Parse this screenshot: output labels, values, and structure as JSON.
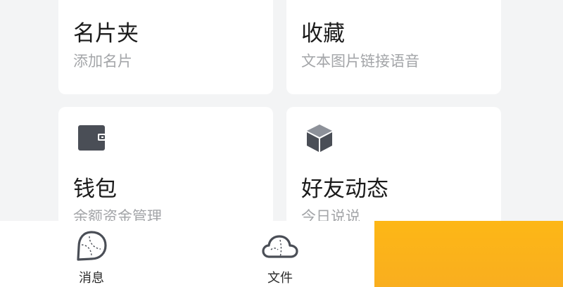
{
  "cards": [
    {
      "title": "名片夹",
      "subtitle": "添加名片"
    },
    {
      "title": "收藏",
      "subtitle": "文本图片链接语音"
    },
    {
      "title": "钱包",
      "subtitle": "余额资金管理",
      "icon": "wallet-icon"
    },
    {
      "title": "好友动态",
      "subtitle": "今日说说",
      "icon": "cube-icon"
    }
  ],
  "tabbar": {
    "items": [
      {
        "label": "消息",
        "icon": "message-bubble-icon"
      },
      {
        "label": "文件",
        "icon": "cloud-icon"
      }
    ]
  },
  "colors": {
    "background": "#f3f4f5",
    "card": "#ffffff",
    "icon_gray": "#4a4e56",
    "subtitle_gray": "#a3a5a8",
    "overlay_orange": "#fbb31a"
  }
}
